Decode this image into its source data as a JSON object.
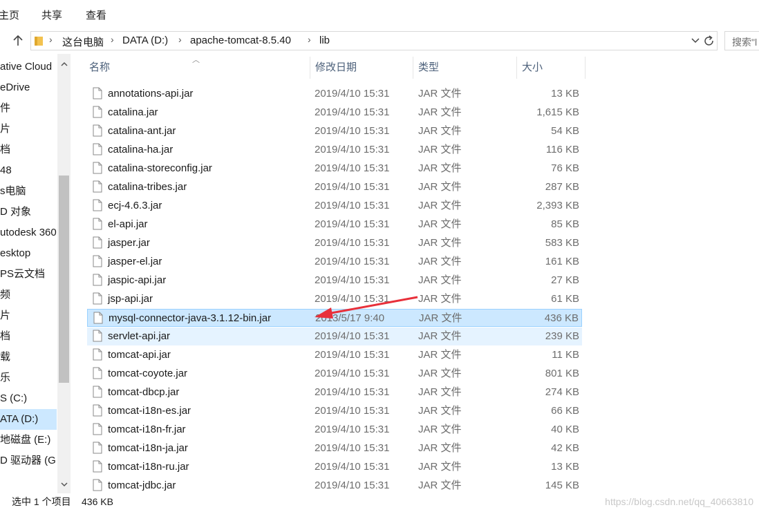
{
  "ribbon": {
    "tabs": [
      "主页",
      "共享",
      "查看"
    ]
  },
  "address": {
    "segments": [
      "这台电脑",
      "DATA (D:)",
      "apache-tomcat-8.5.40",
      "lib"
    ],
    "separator": "›"
  },
  "search": {
    "placeholder": "搜索\"l"
  },
  "sidebar": {
    "items": [
      {
        "label": "ative Cloud",
        "selected": false
      },
      {
        "label": "eDrive",
        "selected": false
      },
      {
        "label": "件",
        "selected": false
      },
      {
        "label": "片",
        "selected": false
      },
      {
        "label": "档",
        "selected": false
      },
      {
        "label": "48",
        "selected": false
      },
      {
        "label": "s电脑",
        "selected": false
      },
      {
        "label": "D 对象",
        "selected": false
      },
      {
        "label": "utodesk 360",
        "selected": false
      },
      {
        "label": "esktop",
        "selected": false
      },
      {
        "label": "PS云文档",
        "selected": false
      },
      {
        "label": "频",
        "selected": false
      },
      {
        "label": "片",
        "selected": false
      },
      {
        "label": "档",
        "selected": false
      },
      {
        "label": "载",
        "selected": false
      },
      {
        "label": "乐",
        "selected": false
      },
      {
        "label": "S (C:)",
        "selected": false
      },
      {
        "label": "ATA (D:)",
        "selected": true
      },
      {
        "label": "地磁盘 (E:)",
        "selected": false
      },
      {
        "label": "D 驱动器 (G:)",
        "selected": false
      }
    ]
  },
  "columns": {
    "name": "名称",
    "date": "修改日期",
    "type": "类型",
    "size": "大小"
  },
  "files": [
    {
      "name": "annotations-api.jar",
      "date": "2019/4/10 15:31",
      "type": "JAR 文件",
      "size": "13 KB",
      "state": ""
    },
    {
      "name": "catalina.jar",
      "date": "2019/4/10 15:31",
      "type": "JAR 文件",
      "size": "1,615 KB",
      "state": ""
    },
    {
      "name": "catalina-ant.jar",
      "date": "2019/4/10 15:31",
      "type": "JAR 文件",
      "size": "54 KB",
      "state": ""
    },
    {
      "name": "catalina-ha.jar",
      "date": "2019/4/10 15:31",
      "type": "JAR 文件",
      "size": "116 KB",
      "state": ""
    },
    {
      "name": "catalina-storeconfig.jar",
      "date": "2019/4/10 15:31",
      "type": "JAR 文件",
      "size": "76 KB",
      "state": ""
    },
    {
      "name": "catalina-tribes.jar",
      "date": "2019/4/10 15:31",
      "type": "JAR 文件",
      "size": "287 KB",
      "state": ""
    },
    {
      "name": "ecj-4.6.3.jar",
      "date": "2019/4/10 15:31",
      "type": "JAR 文件",
      "size": "2,393 KB",
      "state": ""
    },
    {
      "name": "el-api.jar",
      "date": "2019/4/10 15:31",
      "type": "JAR 文件",
      "size": "85 KB",
      "state": ""
    },
    {
      "name": "jasper.jar",
      "date": "2019/4/10 15:31",
      "type": "JAR 文件",
      "size": "583 KB",
      "state": ""
    },
    {
      "name": "jasper-el.jar",
      "date": "2019/4/10 15:31",
      "type": "JAR 文件",
      "size": "161 KB",
      "state": ""
    },
    {
      "name": "jaspic-api.jar",
      "date": "2019/4/10 15:31",
      "type": "JAR 文件",
      "size": "27 KB",
      "state": ""
    },
    {
      "name": "jsp-api.jar",
      "date": "2019/4/10 15:31",
      "type": "JAR 文件",
      "size": "61 KB",
      "state": ""
    },
    {
      "name": "mysql-connector-java-3.1.12-bin.jar",
      "date": "2013/5/17 9:40",
      "type": "JAR 文件",
      "size": "436 KB",
      "state": "selected"
    },
    {
      "name": "servlet-api.jar",
      "date": "2019/4/10 15:31",
      "type": "JAR 文件",
      "size": "239 KB",
      "state": "hover"
    },
    {
      "name": "tomcat-api.jar",
      "date": "2019/4/10 15:31",
      "type": "JAR 文件",
      "size": "11 KB",
      "state": ""
    },
    {
      "name": "tomcat-coyote.jar",
      "date": "2019/4/10 15:31",
      "type": "JAR 文件",
      "size": "801 KB",
      "state": ""
    },
    {
      "name": "tomcat-dbcp.jar",
      "date": "2019/4/10 15:31",
      "type": "JAR 文件",
      "size": "274 KB",
      "state": ""
    },
    {
      "name": "tomcat-i18n-es.jar",
      "date": "2019/4/10 15:31",
      "type": "JAR 文件",
      "size": "66 KB",
      "state": ""
    },
    {
      "name": "tomcat-i18n-fr.jar",
      "date": "2019/4/10 15:31",
      "type": "JAR 文件",
      "size": "40 KB",
      "state": ""
    },
    {
      "name": "tomcat-i18n-ja.jar",
      "date": "2019/4/10 15:31",
      "type": "JAR 文件",
      "size": "42 KB",
      "state": ""
    },
    {
      "name": "tomcat-i18n-ru.jar",
      "date": "2019/4/10 15:31",
      "type": "JAR 文件",
      "size": "13 KB",
      "state": ""
    },
    {
      "name": "tomcat-jdbc.jar",
      "date": "2019/4/10 15:31",
      "type": "JAR 文件",
      "size": "145 KB",
      "state": ""
    }
  ],
  "status": {
    "selection": "选中 1 个项目",
    "selection_size": "436 KB"
  },
  "watermark": "https://blog.csdn.net/qq_40663810",
  "colors": {
    "selection_bg": "#cce8ff",
    "selection_border": "#99d1ff",
    "hover_bg": "#e5f3ff",
    "annotation_arrow": "#e8303a"
  },
  "icons": {
    "up": "arrow-up-icon",
    "folder": "folder-icon",
    "file": "file-icon",
    "refresh": "refresh-icon",
    "dropdown": "chevron-down-icon"
  }
}
